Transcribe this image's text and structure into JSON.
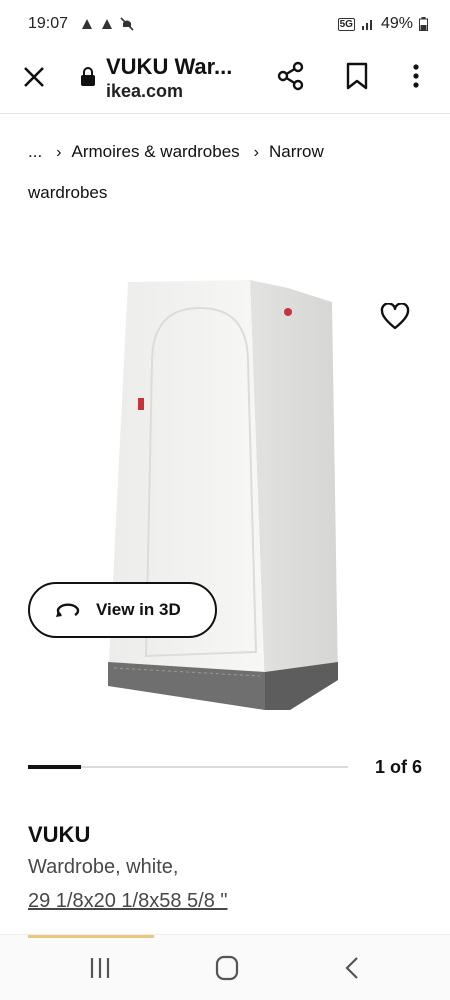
{
  "status_bar": {
    "time": "19:07",
    "network": "5G",
    "battery": "49%"
  },
  "browser": {
    "page_title": "VUKU War...",
    "domain": "ikea.com"
  },
  "breadcrumb": {
    "ellipsis": "...",
    "item1": "Armoires & wardrobes",
    "item2": "Narrow",
    "item2_cont": "wardrobes"
  },
  "media": {
    "view3d_label": "View in 3D",
    "gallery_counter": "1 of 6",
    "gallery_progress": 0.167
  },
  "product": {
    "name": "VUKU",
    "description": "Wardrobe, white,",
    "dimensions": "29 1/8x20 1/8x58 5/8 \""
  },
  "colors": {
    "accent_bar": "#e8c87a",
    "text_primary": "#111111",
    "text_secondary": "#484848"
  }
}
